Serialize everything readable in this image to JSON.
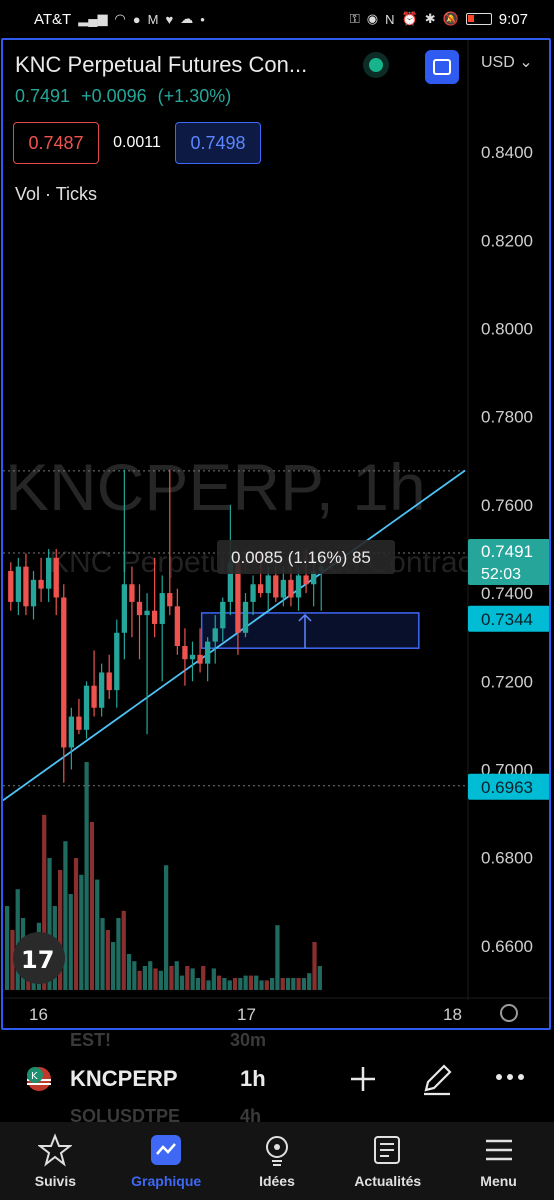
{
  "status": {
    "carrier": "AT&T",
    "time": "9:07"
  },
  "header": {
    "title": "KNC Perpetual Futures Con...",
    "last_price": "0.7491",
    "change": "+0.0096",
    "change_pct": "(+1.30%)",
    "currency": "USD"
  },
  "bid_ask": {
    "bid": "0.7487",
    "spread": "0.0011",
    "ask": "0.7498"
  },
  "indicator": {
    "label": "Vol · Ticks"
  },
  "watermark": {
    "text": "KNCPERP, 1h",
    "subtext": "KNC Perpetual Futures Contract"
  },
  "measure": {
    "label": "0.0085 (1.16%) 85"
  },
  "price_axis": {
    "ticks": [
      "0.8400",
      "0.8200",
      "0.8000",
      "0.7800",
      "0.7600",
      "0.7400",
      "0.7200",
      "0.7000",
      "0.6800",
      "0.6600"
    ],
    "labels": [
      {
        "text": "0.7491",
        "sub": "52:03",
        "color": "#26a69a"
      },
      {
        "text": "0.7344",
        "color": "#00bcd4"
      },
      {
        "text": "0.6963",
        "color": "#00bcd4"
      }
    ]
  },
  "time_axis": {
    "ticks": [
      "16",
      "17",
      "18"
    ]
  },
  "toolbar": {
    "symbol": "KNCPERP",
    "interval": "1h",
    "ghost_top_left": "EST!",
    "ghost_top_right": "30m",
    "ghost_bottom_left": "SOLUSDTPE",
    "ghost_bottom_right": "4h"
  },
  "nav": [
    {
      "label": "Suivis",
      "icon": "star-icon"
    },
    {
      "label": "Graphique",
      "icon": "chart-icon"
    },
    {
      "label": "Idées",
      "icon": "lightbulb-icon"
    },
    {
      "label": "Actualités",
      "icon": "news-icon"
    },
    {
      "label": "Menu",
      "icon": "hamburger-icon"
    }
  ],
  "colors": {
    "up": "#26a69a",
    "down": "#ef5350",
    "accent": "#2f5bf0",
    "trend": "#4fc3f7"
  },
  "chart_data": {
    "type": "candlestick",
    "y_axis": {
      "min": 0.65,
      "max": 0.845,
      "ticks": [
        0.84,
        0.82,
        0.8,
        0.78,
        0.76,
        0.74,
        0.72,
        0.7,
        0.68,
        0.66
      ]
    },
    "candles": [
      [
        0.745,
        0.747,
        0.736,
        0.738
      ],
      [
        0.738,
        0.748,
        0.735,
        0.746
      ],
      [
        0.746,
        0.749,
        0.735,
        0.737
      ],
      [
        0.737,
        0.745,
        0.734,
        0.743
      ],
      [
        0.743,
        0.748,
        0.738,
        0.741
      ],
      [
        0.741,
        0.75,
        0.738,
        0.748
      ],
      [
        0.748,
        0.75,
        0.735,
        0.739
      ],
      [
        0.739,
        0.742,
        0.697,
        0.705
      ],
      [
        0.705,
        0.714,
        0.7,
        0.712
      ],
      [
        0.712,
        0.716,
        0.708,
        0.709
      ],
      [
        0.709,
        0.72,
        0.707,
        0.719
      ],
      [
        0.719,
        0.727,
        0.712,
        0.714
      ],
      [
        0.714,
        0.724,
        0.712,
        0.722
      ],
      [
        0.722,
        0.726,
        0.716,
        0.718
      ],
      [
        0.718,
        0.734,
        0.714,
        0.731
      ],
      [
        0.731,
        0.768,
        0.725,
        0.742
      ],
      [
        0.742,
        0.746,
        0.73,
        0.738
      ],
      [
        0.738,
        0.742,
        0.725,
        0.735
      ],
      [
        0.735,
        0.74,
        0.708,
        0.736
      ],
      [
        0.736,
        0.748,
        0.73,
        0.733
      ],
      [
        0.733,
        0.744,
        0.72,
        0.74
      ],
      [
        0.74,
        0.768,
        0.735,
        0.737
      ],
      [
        0.737,
        0.741,
        0.726,
        0.728
      ],
      [
        0.728,
        0.732,
        0.719,
        0.725
      ],
      [
        0.725,
        0.729,
        0.72,
        0.726
      ],
      [
        0.726,
        0.732,
        0.722,
        0.724
      ],
      [
        0.724,
        0.73,
        0.72,
        0.729
      ],
      [
        0.729,
        0.735,
        0.724,
        0.732
      ],
      [
        0.732,
        0.739,
        0.729,
        0.738
      ],
      [
        0.738,
        0.76,
        0.735,
        0.747
      ],
      [
        0.747,
        0.748,
        0.726,
        0.731
      ],
      [
        0.731,
        0.74,
        0.73,
        0.738
      ],
      [
        0.738,
        0.744,
        0.735,
        0.742
      ],
      [
        0.742,
        0.749,
        0.739,
        0.74
      ],
      [
        0.74,
        0.746,
        0.736,
        0.744
      ],
      [
        0.744,
        0.748,
        0.738,
        0.739
      ],
      [
        0.739,
        0.746,
        0.737,
        0.743
      ],
      [
        0.743,
        0.748,
        0.737,
        0.739
      ],
      [
        0.739,
        0.746,
        0.736,
        0.744
      ],
      [
        0.744,
        0.75,
        0.74,
        0.742
      ],
      [
        0.742,
        0.748,
        0.737,
        0.745
      ],
      [
        0.745,
        0.749,
        0.736,
        0.746
      ]
    ],
    "volumes": [
      0.35,
      0.25,
      0.42,
      0.3,
      0.22,
      0.2,
      0.28,
      0.73,
      0.55,
      0.35,
      0.5,
      0.62,
      0.4,
      0.55,
      0.48,
      0.95,
      0.7,
      0.46,
      0.3,
      0.25,
      0.2,
      0.3,
      0.33,
      0.15,
      0.12,
      0.08,
      0.1,
      0.12,
      0.09,
      0.08,
      0.52,
      0.1,
      0.12,
      0.06,
      0.1,
      0.09,
      0.05,
      0.1,
      0.04,
      0.09,
      0.06,
      0.05,
      0.04,
      0.05,
      0.05,
      0.06,
      0.06,
      0.06,
      0.04,
      0.04,
      0.05,
      0.27,
      0.05,
      0.05,
      0.05,
      0.05,
      0.05,
      0.07,
      0.2,
      0.1
    ],
    "levels": [
      0.7677,
      0.7491,
      0.7344,
      0.6963
    ],
    "trendline": [
      [
        0,
        0.693
      ],
      [
        1,
        0.7678
      ]
    ],
    "box": {
      "x0": 0.43,
      "x1": 0.9,
      "low": 0.7275,
      "high": 0.7355
    }
  }
}
